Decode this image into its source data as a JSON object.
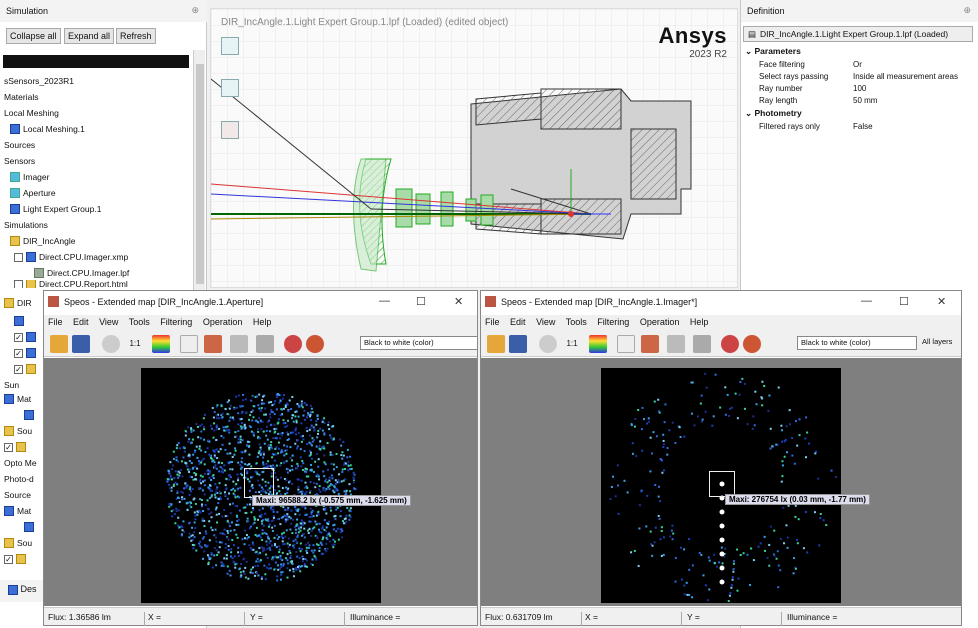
{
  "simulation_panel": {
    "title": "Simulation",
    "buttons": [
      "Collapse all",
      "Expand all",
      "Refresh"
    ],
    "tree": [
      {
        "label": "sSensors_2023R1",
        "icon": ""
      },
      {
        "label": "Materials",
        "icon": ""
      },
      {
        "label": "Local Meshing",
        "icon": ""
      },
      {
        "label": "Local Meshing.1",
        "icon": "mesh-icon"
      },
      {
        "label": "Sources",
        "icon": ""
      },
      {
        "label": "Sensors",
        "icon": ""
      },
      {
        "label": "Imager",
        "icon": "sensor-icon"
      },
      {
        "label": "Aperture",
        "icon": "sensor-icon"
      },
      {
        "label": "Light Expert Group.1",
        "icon": "group-icon"
      },
      {
        "label": "Simulations",
        "icon": ""
      },
      {
        "label": "DIR_IncAngle",
        "icon": "simulation-icon"
      },
      {
        "label": "Direct.CPU.Imager.xmp",
        "icon": "result-icon"
      },
      {
        "label": "Direct.CPU.Imager.lpf",
        "icon": "result-icon"
      },
      {
        "label": "Direct.CPU.Report.html",
        "icon": "report-icon"
      }
    ],
    "partial_items": [
      "DIR",
      "Sun",
      "Mat",
      "Sou",
      "Opto Me",
      "Photo-d",
      "Source",
      "Mat",
      "Sou"
    ],
    "footer": "Des"
  },
  "viewport": {
    "title": "DIR_IncAngle.1.Light Expert Group.1.lpf (Loaded) (edited object)",
    "logo": "Ansys",
    "version": "2023 R2"
  },
  "definition_panel": {
    "title": "Definition",
    "object": "DIR_IncAngle.1.Light Expert Group.1.lpf (Loaded)",
    "sections": [
      {
        "name": "Parameters",
        "rows": [
          {
            "key": "Face filtering",
            "value": "Or"
          },
          {
            "key": "Select rays passing",
            "value": "Inside all measurement areas"
          },
          {
            "key": "Ray number",
            "value": "100"
          },
          {
            "key": "Ray length",
            "value": "50 mm"
          }
        ]
      },
      {
        "name": "Photometry",
        "rows": [
          {
            "key": "Filtered rays only",
            "value": "False"
          }
        ]
      }
    ]
  },
  "map_left": {
    "title": "Speos - Extended map [DIR_IncAngle.1.Aperture]",
    "menu": [
      "File",
      "Edit",
      "View",
      "Tools",
      "Filtering",
      "Operation",
      "Help"
    ],
    "colormap": "Black to white (color)",
    "max_label": "Maxi: 96588.2 lx (-0.575 mm, -1.625 mm)",
    "status": {
      "flux": "Flux: 1.36586 lm",
      "x": "X =",
      "y": "Y =",
      "illum": "Illuminance ="
    }
  },
  "map_right": {
    "title": "Speos - Extended map [DIR_IncAngle.1.Imager*]",
    "menu": [
      "File",
      "Edit",
      "View",
      "Tools",
      "Filtering",
      "Operation",
      "Help"
    ],
    "colormap": "Black to white (color)",
    "layers": "All layers",
    "max_label": "Maxi: 276754 lx (0.03 mm, -1.77 mm)",
    "status": {
      "flux": "Flux: 0.631709 lm",
      "x": "X =",
      "y": "Y =",
      "illum": "Illuminance ="
    }
  },
  "colors": {
    "accent": "#3b6fd6",
    "map_bg": "#000000",
    "canvas_bg": "#7f7f7f"
  }
}
